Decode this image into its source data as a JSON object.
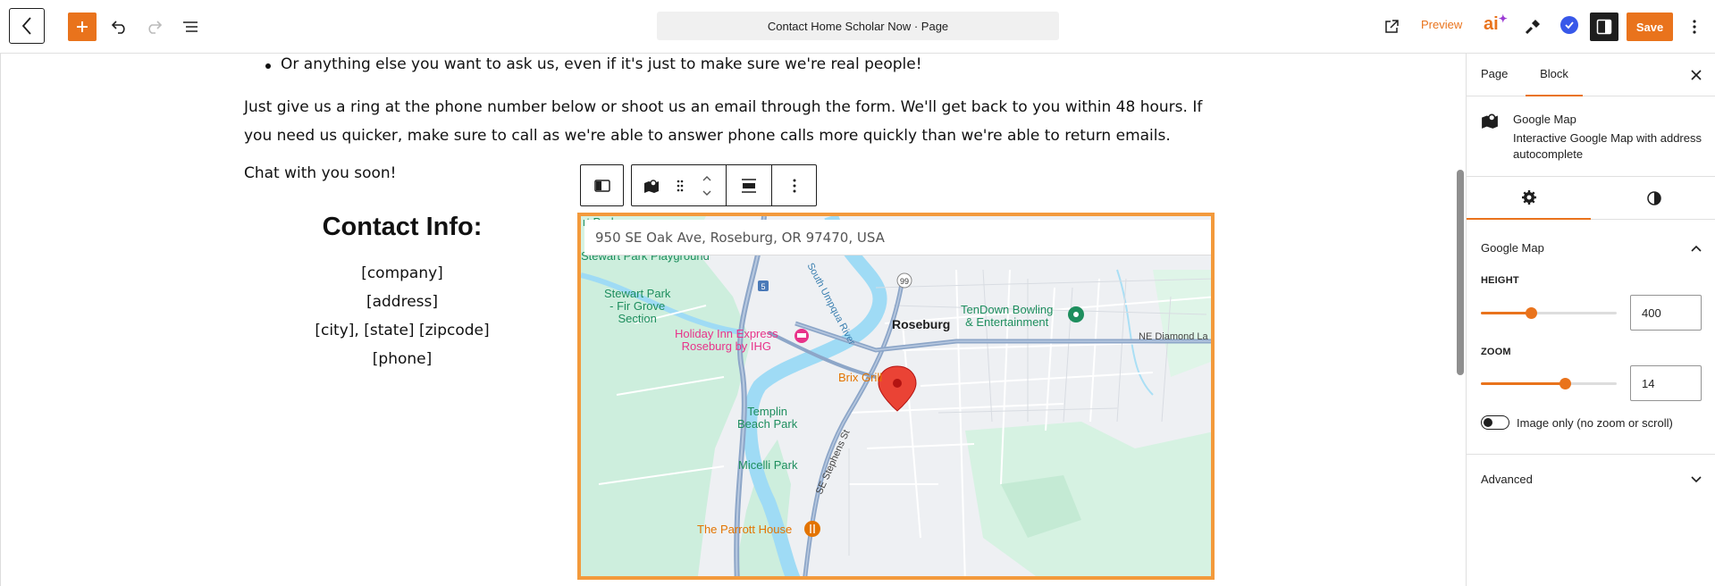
{
  "header": {
    "title": "Contact Home Scholar Now · Page",
    "preview_label": "Preview",
    "save_label": "Save",
    "ai_label": "ai"
  },
  "content": {
    "bullet": "Or anything else you want to ask us, even if it's just to make sure we're real people!",
    "paragraph": "Just give us a ring at the phone number below or shoot us an email through the form. We'll get back to you within 48 hours. If you need us quicker, make sure to call as we're able to answer phone calls more quickly than we're able to return emails.",
    "chat": "Chat with you soon!",
    "contact_heading": "Contact Info:",
    "contact_lines": [
      "[company]",
      "[address]",
      "[city], [state] [zipcode]",
      "[phone]"
    ]
  },
  "map": {
    "address": "950 SE Oak Ave, Roseburg, OR 97470, USA",
    "labels": {
      "stewart_top": "Stewart Park Playground",
      "stewart_section": "Stewart Park\n- Fir Grove\nSection",
      "holiday": "Holiday Inn Express\nRoseburg by IHG",
      "south_umpqua": "South Umpqua River",
      "roseburg": "Roseburg",
      "tendown": "TenDown Bowling\n& Entertainment",
      "ne_diamond": "NE Diamond La",
      "brix": "Brix Grill",
      "templin": "Templin\nBeach Park",
      "micelli": "Micelli Park",
      "stephens": "SE Stephens St",
      "parrott": "The Parrott House",
      "route_5": "5",
      "route_99": "99",
      "top_park": "rt Park"
    }
  },
  "sidebar": {
    "tabs": [
      "Page",
      "Block"
    ],
    "active_tab": "Block",
    "block_name": "Google Map",
    "block_description": "Interactive Google Map with address autocomplete",
    "panel_title": "Google Map",
    "height_label": "HEIGHT",
    "height_value": "400",
    "height_level": 0.37,
    "zoom_label": "ZOOM",
    "zoom_value": "14",
    "zoom_level": 0.62,
    "toggle_label": "Image only (no zoom or scroll)",
    "toggle_on": false,
    "advanced_label": "Advanced"
  },
  "colors": {
    "accent": "#e9731c",
    "map_border": "#f39a3c",
    "pin": "#ea4335",
    "hotel_pink": "#e8338a",
    "poi_green": "#1e8e5e",
    "food_orange": "#e37400"
  }
}
